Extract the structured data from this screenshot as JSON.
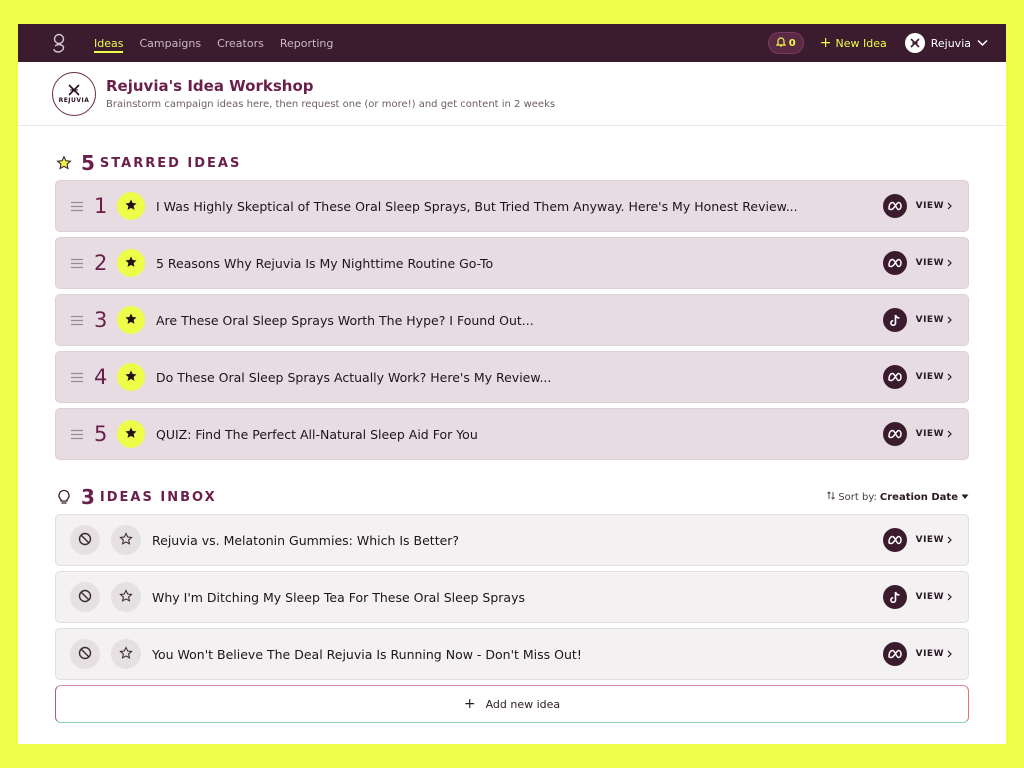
{
  "nav": {
    "links": [
      {
        "label": "Ideas",
        "active": true
      },
      {
        "label": "Campaigns",
        "active": false
      },
      {
        "label": "Creators",
        "active": false
      },
      {
        "label": "Reporting",
        "active": false
      }
    ],
    "notifications_count": "0",
    "new_idea_label": "New Idea",
    "account_name": "Rejuvia"
  },
  "header": {
    "brand_mark": "REJUVIA",
    "title": "Rejuvia's Idea Workshop",
    "subtitle": "Brainstorm campaign ideas here, then request one (or more!) and get content in 2 weeks"
  },
  "starred": {
    "count": "5",
    "label": "Starred Ideas",
    "items": [
      {
        "rank": "1",
        "title": "I Was Highly Skeptical of These Oral Sleep Sprays, But Tried Them Anyway. Here's My Honest Review...",
        "platform": "meta-icon",
        "view": "VIEW"
      },
      {
        "rank": "2",
        "title": "5 Reasons Why Rejuvia Is My Nighttime Routine Go-To",
        "platform": "meta-icon",
        "view": "VIEW"
      },
      {
        "rank": "3",
        "title": "Are These Oral Sleep Sprays Worth The Hype? I Found Out...",
        "platform": "tiktok-icon",
        "view": "VIEW"
      },
      {
        "rank": "4",
        "title": "Do These Oral Sleep Sprays Actually Work? Here's My Review...",
        "platform": "meta-icon",
        "view": "VIEW"
      },
      {
        "rank": "5",
        "title": "QUIZ: Find The Perfect All-Natural Sleep Aid For You",
        "platform": "meta-icon",
        "view": "VIEW"
      }
    ]
  },
  "inbox": {
    "count": "3",
    "label": "Ideas Inbox",
    "sort_label": "Sort by:",
    "sort_value": "Creation Date",
    "items": [
      {
        "title": "Rejuvia vs. Melatonin Gummies: Which Is Better?",
        "platform": "meta-icon",
        "view": "VIEW"
      },
      {
        "title": "Why I'm Ditching My Sleep Tea For These Oral Sleep Sprays",
        "platform": "tiktok-icon",
        "view": "VIEW"
      },
      {
        "title": "You Won't Believe The Deal Rejuvia Is Running Now - Don't Miss Out!",
        "platform": "meta-icon",
        "view": "VIEW"
      }
    ]
  },
  "add_idea_label": "Add new idea",
  "colors": {
    "background": "#eefc4a",
    "nav": "#3b1c2e",
    "accent": "#eefc4a",
    "brand": "#6a1f4a",
    "starred_row": "#e6dce2",
    "inbox_row": "#f3f1f2"
  }
}
